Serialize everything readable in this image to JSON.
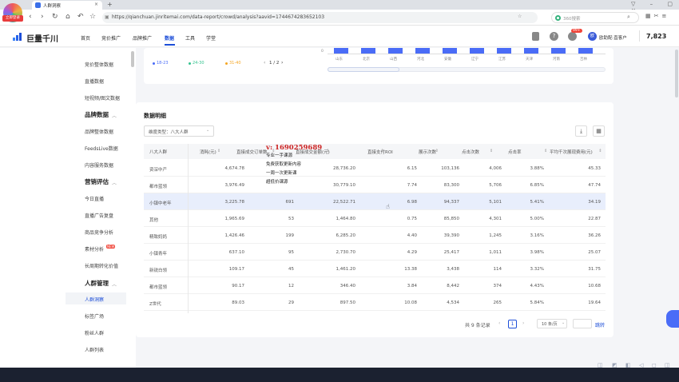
{
  "browser": {
    "badge": "立即登录",
    "tab_title": "人群洞察",
    "url": "https://qianchuan.jinritemai.com/data-report/crowd/analysis?aavid=1744674283652103",
    "search_placeholder": "360搜索"
  },
  "app": {
    "logo": "巨量千川",
    "menu": [
      "首页",
      "竞价推广",
      "品牌推广",
      "数据",
      "工具",
      "学堂"
    ],
    "active_menu": "数据",
    "badge": "99+",
    "account": "欧助配·直客户",
    "balance": "7,823"
  },
  "sidebar": {
    "items": [
      {
        "label": "竞价整体数据",
        "type": "item"
      },
      {
        "label": "直播数据",
        "type": "item"
      },
      {
        "label": "短视频/图文数据",
        "type": "item"
      },
      {
        "label": "品牌数据",
        "type": "group"
      },
      {
        "label": "品牌整体数据",
        "type": "item"
      },
      {
        "label": "FeedsLive数据",
        "type": "item"
      },
      {
        "label": "内容服务数据",
        "type": "item"
      },
      {
        "label": "营销评估",
        "type": "group"
      },
      {
        "label": "今日直播",
        "type": "item"
      },
      {
        "label": "直播广告复盘",
        "type": "item"
      },
      {
        "label": "商品竞争分析",
        "type": "item"
      },
      {
        "label": "素材分析",
        "type": "item",
        "tag": "NEW"
      },
      {
        "label": "长周期转化价值",
        "type": "item"
      },
      {
        "label": "人群管理",
        "type": "group"
      },
      {
        "label": "人群洞察",
        "type": "item",
        "active": true
      },
      {
        "label": "标签广场",
        "type": "item"
      },
      {
        "label": "粉丝人群",
        "type": "item"
      },
      {
        "label": "人群列表",
        "type": "item"
      }
    ]
  },
  "top_chart": {
    "legend": [
      "18-23",
      "24-30",
      "31-40"
    ],
    "legend_colors": [
      "#4a6cf7",
      "#34c38f",
      "#f5a623"
    ],
    "pager": "1 / 2",
    "axis_zero": "0",
    "categories": [
      "山东",
      "北京",
      "山西",
      "河北",
      "安徽",
      "辽宁",
      "江苏",
      "天津",
      "河南",
      "吉林"
    ]
  },
  "detail": {
    "title": "数据明细",
    "dim_select": "维度类型：八大人群",
    "columns": [
      "八大人群",
      "消耗(元)",
      "直接成交订单数",
      "直接成交金额(元)",
      "直接支付ROI",
      "展示次数",
      "点击次数",
      "点击率",
      "平均千次展现费用(元)"
    ],
    "rows": [
      [
        "资深中产",
        "4,674.78",
        "",
        "28,736.20",
        "6.15",
        "103,136",
        "4,006",
        "3.88%",
        "45.33"
      ],
      [
        "都市蓝领",
        "3,976.49",
        "",
        "30,779.10",
        "7.74",
        "83,300",
        "5,706",
        "6.85%",
        "47.74"
      ],
      [
        "小镇中老年",
        "3,225.78",
        "691",
        "22,522.71",
        "6.98",
        "94,337",
        "5,101",
        "5.41%",
        "34.19"
      ],
      [
        "其他",
        "1,965.69",
        "53",
        "1,464.80",
        "0.75",
        "85,850",
        "4,301",
        "5.00%",
        "22.87"
      ],
      [
        "精致妈妈",
        "1,426.46",
        "199",
        "6,285.20",
        "4.40",
        "39,390",
        "1,245",
        "3.16%",
        "36.26"
      ],
      [
        "小镇青年",
        "637.10",
        "95",
        "2,730.70",
        "4.29",
        "25,417",
        "1,011",
        "3.98%",
        "25.07"
      ],
      [
        "新锐白领",
        "109.17",
        "45",
        "1,461.20",
        "13.38",
        "3,438",
        "114",
        "3.32%",
        "31.75"
      ],
      [
        "都市蓝领",
        "90.17",
        "12",
        "346.40",
        "3.84",
        "8,442",
        "374",
        "4.43%",
        "10.68"
      ],
      [
        "Z世代",
        "89.03",
        "29",
        "897.50",
        "10.08",
        "4,534",
        "265",
        "5.84%",
        "19.64"
      ]
    ],
    "highlight_row": 2,
    "total": "共 9 条记录",
    "page": "1",
    "page_size": "10 条/页",
    "jump": "跳转"
  },
  "watermark": {
    "main": "v: 1690259689",
    "lines": [
      "专业一手课源",
      "免费获取更新内容",
      "一周一次更新课",
      "超低价课源"
    ]
  }
}
